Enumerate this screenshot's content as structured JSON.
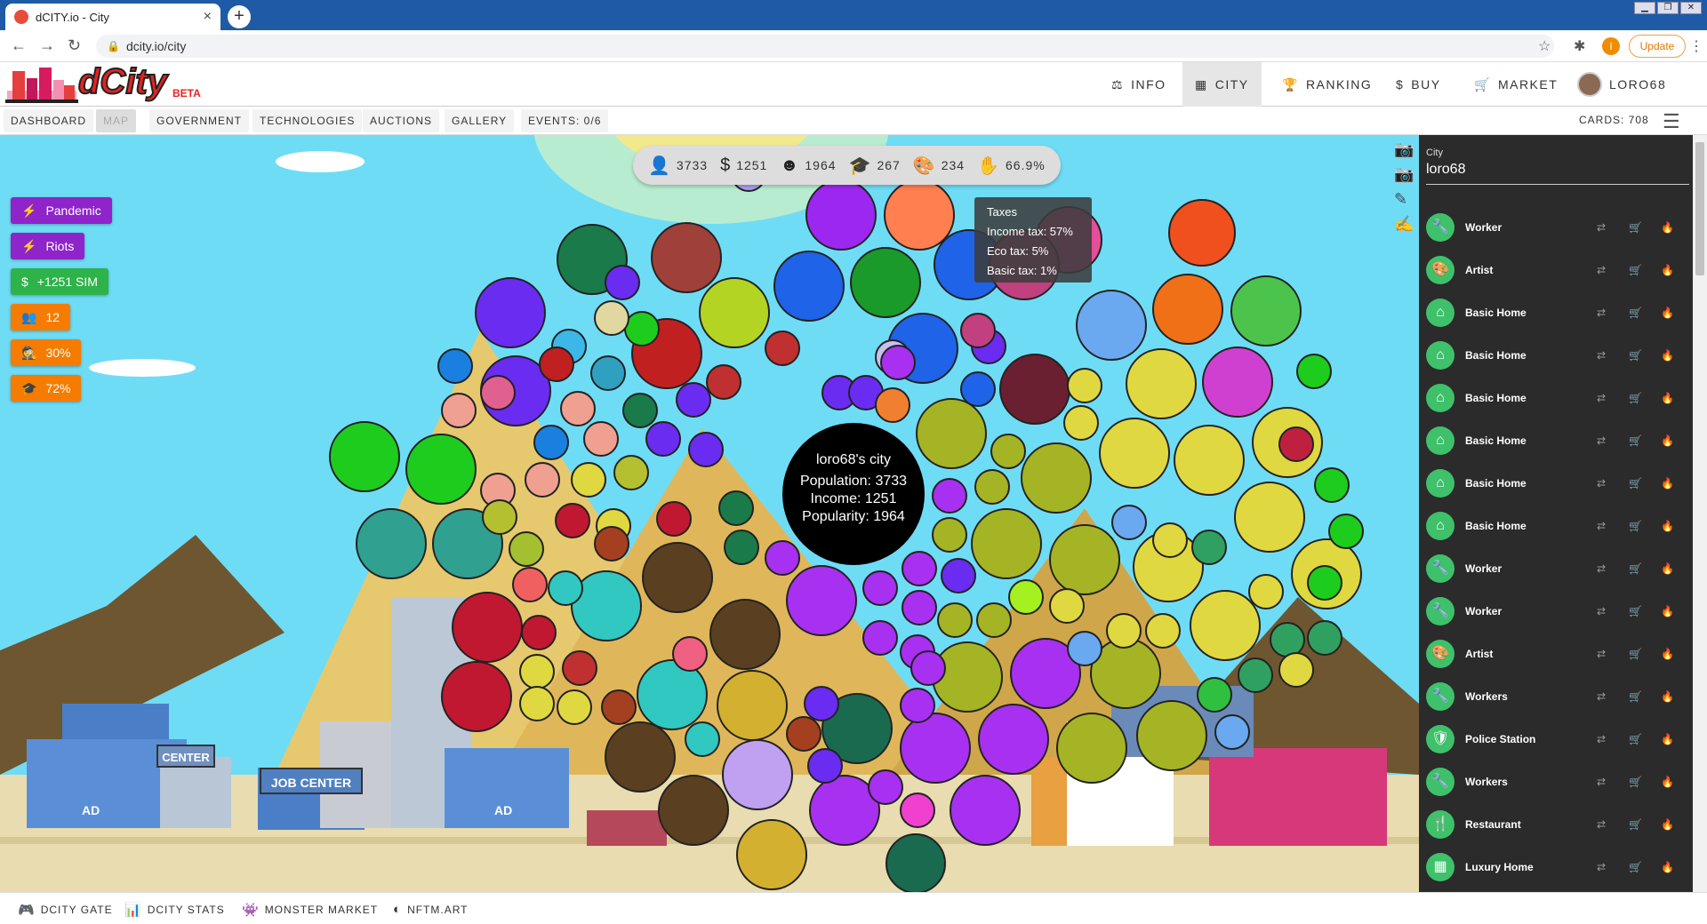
{
  "browser": {
    "tab_title": "dCITY.io - City",
    "tab_close": "×",
    "new_tab": "+",
    "url": "dcity.io/city",
    "profile_initial": "I",
    "update_label": "Update",
    "window_controls": [
      "▁",
      "❐",
      "✕"
    ]
  },
  "header": {
    "logo_word": "dCity",
    "logo_beta": "BETA",
    "nav": [
      {
        "label": "INFO",
        "icon": "⚖"
      },
      {
        "label": "CITY",
        "icon": "▦"
      },
      {
        "label": "RANKING",
        "icon": "🏆"
      },
      {
        "label": "BUY",
        "icon": "$"
      },
      {
        "label": "MARKET",
        "icon": "🛒"
      },
      {
        "label": "LORO68",
        "icon": ""
      }
    ]
  },
  "subnav": {
    "tabs": [
      "DASHBOARD",
      "MAP",
      "GOVERNMENT",
      "TECHNOLOGIES",
      "AUCTIONS",
      "GALLERY",
      "EVENTS: 0/6"
    ],
    "cards": "CARDS: 708"
  },
  "stats": [
    {
      "icon": "person-icon",
      "glyph": "👤",
      "value": "3733"
    },
    {
      "icon": "dollar-icon",
      "glyph": "$",
      "value": "1251"
    },
    {
      "icon": "smile-icon",
      "glyph": "☻",
      "value": "1964"
    },
    {
      "icon": "graduation-cap-icon",
      "glyph": "🎓",
      "value": "267"
    },
    {
      "icon": "palette-icon",
      "glyph": "🎨",
      "value": "234"
    },
    {
      "icon": "hand-coin-icon",
      "glyph": "✋",
      "value": "66.9%"
    }
  ],
  "events": [
    {
      "label": "Pandemic",
      "icon": "⚡",
      "color": "#8e24c9"
    },
    {
      "label": "Riots",
      "icon": "⚡",
      "color": "#8e24c9"
    },
    {
      "label": "+1251 SIM",
      "icon": "$",
      "color": "#2db34a"
    },
    {
      "label": "12",
      "icon": "👥",
      "color": "#f57c00"
    },
    {
      "label": "30%",
      "icon": "🕵",
      "color": "#f57c00"
    },
    {
      "label": "72%",
      "icon": "🎓",
      "color": "#f57c00"
    }
  ],
  "tooltip": {
    "title": "Taxes",
    "lines": [
      "Income tax: 57%",
      "Eco tax: 5%",
      "Basic tax: 1%"
    ]
  },
  "center": {
    "title": "loro68's city",
    "population": "Population: 3733",
    "income": "Income: 1251",
    "popularity": "Popularity: 1964"
  },
  "sidebar": {
    "label": "City",
    "name": "loro68",
    "items": [
      {
        "name": "Worker",
        "icon": "🔧"
      },
      {
        "name": "Artist",
        "icon": "🎨"
      },
      {
        "name": "Basic Home",
        "icon": "⌂"
      },
      {
        "name": "Basic Home",
        "icon": "⌂"
      },
      {
        "name": "Basic Home",
        "icon": "⌂"
      },
      {
        "name": "Basic Home",
        "icon": "⌂"
      },
      {
        "name": "Basic Home",
        "icon": "⌂"
      },
      {
        "name": "Basic Home",
        "icon": "⌂"
      },
      {
        "name": "Worker",
        "icon": "🔧"
      },
      {
        "name": "Worker",
        "icon": "🔧"
      },
      {
        "name": "Artist",
        "icon": "🎨"
      },
      {
        "name": "Workers",
        "icon": "🔧"
      },
      {
        "name": "Police Station",
        "icon": "🛡"
      },
      {
        "name": "Workers",
        "icon": "🔧"
      },
      {
        "name": "Restaurant",
        "icon": "🍴"
      },
      {
        "name": "Luxury Home",
        "icon": "▦"
      }
    ],
    "actions": [
      "⇄",
      "🛒",
      "🔥"
    ]
  },
  "map_labels": {
    "center_sign": "CENTER",
    "job_center": "JOB CENTER",
    "ad": "AD"
  },
  "footer": [
    {
      "label": "DCITY GATE",
      "icon": "🎮"
    },
    {
      "label": "DCITY STATS",
      "icon": "📊"
    },
    {
      "label": "MONSTER MARKET",
      "icon": "👾"
    },
    {
      "label": "NFTM.ART",
      "icon": "◐"
    }
  ],
  "colors": {
    "sky": "#6fdcf5",
    "sidebar_bg": "#2b2b2b",
    "sidebar_badge": "#3ec16a",
    "accent_red": "#e52222"
  }
}
